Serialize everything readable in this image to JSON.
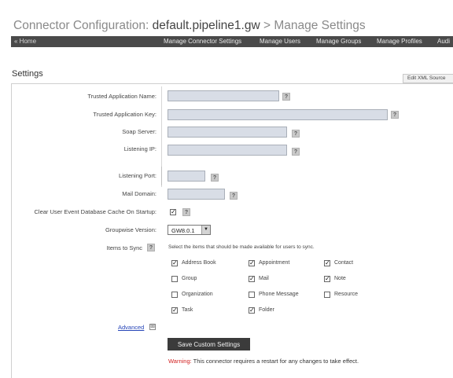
{
  "header": {
    "title_prefix": "Connector Configuration: ",
    "title_main": "default.pipeline1.gw",
    "title_suffix": " > Manage Settings"
  },
  "nav": {
    "home": "« Home",
    "items": [
      "Manage Connector Settings",
      "Manage Users",
      "Manage Groups",
      "Manage Profiles",
      "Audi"
    ]
  },
  "section_title": "Settings",
  "edit_xml_button": "Edit XML Source",
  "fields": {
    "trusted_app_name": "Trusted Application Name:",
    "trusted_app_key": "Trusted Application Key:",
    "soap_server": "Soap Server:",
    "listening_ip": "Listening IP:",
    "listening_port": "Listening Port:",
    "mail_domain": "Mail Domain:",
    "clear_cache": "Clear User Event Database Cache On Startup:",
    "groupwise_version": "Groupwise Version:",
    "items_to_sync": "Items to Sync"
  },
  "help_glyph": "?",
  "groupwise_version_value": "GW8.0.1",
  "clear_cache_checked": true,
  "sync_description": "Select the items that should be made available for users to sync.",
  "sync_items": [
    {
      "label": "Address Book",
      "checked": true
    },
    {
      "label": "Appointment",
      "checked": true
    },
    {
      "label": "Contact",
      "checked": true
    },
    {
      "label": "Group",
      "checked": false
    },
    {
      "label": "Mail",
      "checked": true
    },
    {
      "label": "Note",
      "checked": true
    },
    {
      "label": "Organization",
      "checked": false
    },
    {
      "label": "Phone Message",
      "checked": false
    },
    {
      "label": "Resource",
      "checked": false
    },
    {
      "label": "Task",
      "checked": true
    },
    {
      "label": "Folder",
      "checked": true
    }
  ],
  "advanced_link": "Advanced",
  "advanced_icon": "⊞",
  "save_button": "Save Custom Settings",
  "warning_prefix": "Warning:",
  "warning_text": " This connector requires a restart for any changes to take effect.",
  "colors": {
    "navbar": "#4a4a4a",
    "input_fill": "#d8dde6",
    "link": "#2746b8",
    "warning": "#d21f1f"
  }
}
